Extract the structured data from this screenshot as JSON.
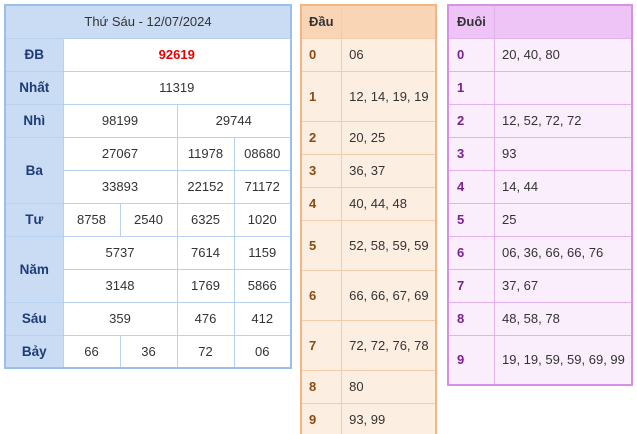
{
  "results": {
    "header": "Thứ Sáu - 12/07/2024",
    "rows": {
      "db": {
        "label": "ĐB",
        "values": [
          "92619"
        ]
      },
      "nhat": {
        "label": "Nhất",
        "values": [
          "11319"
        ]
      },
      "nhi": {
        "label": "Nhì",
        "values": [
          "98199",
          "29744"
        ]
      },
      "ba": {
        "label": "Ba",
        "values": [
          "27067",
          "11978",
          "08680",
          "33893",
          "22152",
          "71172"
        ]
      },
      "tu": {
        "label": "Tư",
        "values": [
          "8758",
          "2540",
          "6325",
          "1020"
        ]
      },
      "nam": {
        "label": "Năm",
        "values": [
          "5737",
          "7614",
          "1159",
          "3148",
          "1769",
          "5866"
        ]
      },
      "sau": {
        "label": "Sáu",
        "values": [
          "359",
          "476",
          "412"
        ]
      },
      "bay": {
        "label": "Bảy",
        "values": [
          "66",
          "36",
          "72",
          "06"
        ]
      }
    }
  },
  "heads": {
    "header": "Đầu",
    "rows": [
      {
        "digit": "0",
        "values": "06"
      },
      {
        "digit": "1",
        "values": "12, 14, 19, 19"
      },
      {
        "digit": "2",
        "values": "20, 25"
      },
      {
        "digit": "3",
        "values": "36, 37"
      },
      {
        "digit": "4",
        "values": "40, 44, 48"
      },
      {
        "digit": "5",
        "values": "52, 58, 59, 59"
      },
      {
        "digit": "6",
        "values": "66, 66, 67, 69"
      },
      {
        "digit": "7",
        "values": "72, 72, 76, 78"
      },
      {
        "digit": "8",
        "values": "80"
      },
      {
        "digit": "9",
        "values": "93, 99"
      }
    ]
  },
  "tails": {
    "header": "Đuôi",
    "rows": [
      {
        "digit": "0",
        "values": "20, 40, 80"
      },
      {
        "digit": "1",
        "values": ""
      },
      {
        "digit": "2",
        "values": "12, 52, 72, 72"
      },
      {
        "digit": "3",
        "values": "93"
      },
      {
        "digit": "4",
        "values": "14, 44"
      },
      {
        "digit": "5",
        "values": "25"
      },
      {
        "digit": "6",
        "values": "06, 36, 66, 66, 76"
      },
      {
        "digit": "7",
        "values": "37, 67"
      },
      {
        "digit": "8",
        "values": "48, 58, 78"
      },
      {
        "digit": "9",
        "values": "19, 19, 59, 59, 69, 99"
      }
    ]
  },
  "colors": {
    "special_prize": "#e60000",
    "results_header": "#c9dcf3",
    "heads_header": "#f9d5b6",
    "tails_header": "#eec3f5"
  }
}
